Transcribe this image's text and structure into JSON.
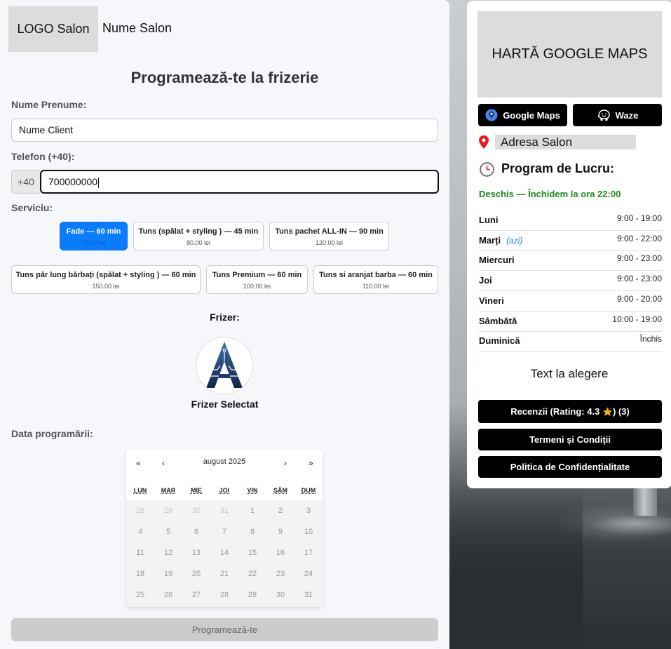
{
  "header": {
    "logo_text": "LOGO Salon",
    "salon_name": "Nume Salon"
  },
  "form": {
    "title": "Programează-te la frizerie",
    "name_label": "Nume Prenume:",
    "name_value": "Nume Client",
    "phone_label": "Telefon (+40):",
    "phone_prefix": "+40",
    "phone_value": "700000000",
    "service_label": "Serviciu:",
    "services": [
      {
        "name": "Fade — 60 min",
        "price": "70.00 lei",
        "selected": true
      },
      {
        "name": "Tuns (spălat + styling ) — 45 min",
        "price": "80.00 lei",
        "selected": false
      },
      {
        "name": "Tuns pachet ALL-IN — 90 min",
        "price": "120.00 lei",
        "selected": false
      },
      {
        "name": "Tuns păr lung bărbați (spălat + styling ) — 60 min",
        "price": "150.00 lei",
        "selected": false
      },
      {
        "name": "Tuns Premium — 60 min",
        "price": "100.00 lei",
        "selected": false
      },
      {
        "name": "Tuns si aranjat barba — 60 min",
        "price": "110.00 lei",
        "selected": false
      }
    ],
    "barber_label": "Frizer:",
    "barber_name": "Frizer Selectat",
    "date_label": "Data programării:",
    "submit_label": "Programează-te"
  },
  "calendar": {
    "month_label": "august 2025",
    "nav": {
      "prev_year": "«",
      "prev_month": "‹",
      "next_month": "›",
      "next_year": "»"
    },
    "weekdays": [
      "LUN",
      "MAR",
      "MIE",
      "JOI",
      "VIN",
      "SÂM",
      "DUM"
    ],
    "weeks": [
      [
        "28",
        "29",
        "30",
        "31",
        "1",
        "2",
        "3"
      ],
      [
        "4",
        "5",
        "6",
        "7",
        "8",
        "9",
        "10"
      ],
      [
        "11",
        "12",
        "13",
        "14",
        "15",
        "16",
        "17"
      ],
      [
        "18",
        "19",
        "20",
        "21",
        "22",
        "23",
        "24"
      ],
      [
        "25",
        "26",
        "27",
        "28",
        "29",
        "30",
        "31"
      ]
    ],
    "outside_month_first_row_count": 4
  },
  "sidebar": {
    "map_placeholder": "HARTĂ GOOGLE MAPS",
    "google_maps_label": "Google Maps",
    "waze_label": "Waze",
    "address": "Adresa Salon",
    "schedule_title": "Program de Lucru:",
    "open_status": "Deschis — Închidem la ora 22:00",
    "today_tag": "(azi)",
    "schedule": [
      {
        "day": "Luni",
        "hours": "9:00 - 19:00",
        "today": false
      },
      {
        "day": "Marți",
        "hours": "9:00 - 22:00",
        "today": true
      },
      {
        "day": "Miercuri",
        "hours": "9:00 - 23:00",
        "today": false
      },
      {
        "day": "Joi",
        "hours": "9:00 - 23:00",
        "today": false
      },
      {
        "day": "Vineri",
        "hours": "9:00 - 20:00",
        "today": false
      },
      {
        "day": "Sâmbătă",
        "hours": "10:00 - 19:00",
        "today": false
      },
      {
        "day": "Duminică",
        "hours": "Închis",
        "today": false
      }
    ],
    "custom_text": "Text la alegere",
    "reviews_prefix": "Recenzii (Rating: 4.3 ",
    "reviews_suffix": ") (3)",
    "terms_label": "Termeni și Condiții",
    "privacy_label": "Politica de Confidențialitate"
  },
  "colors": {
    "accent": "#0a7cff",
    "open_status": "#1a8a1a",
    "today_tag": "#2a7ad8",
    "button_dark": "#000000"
  }
}
